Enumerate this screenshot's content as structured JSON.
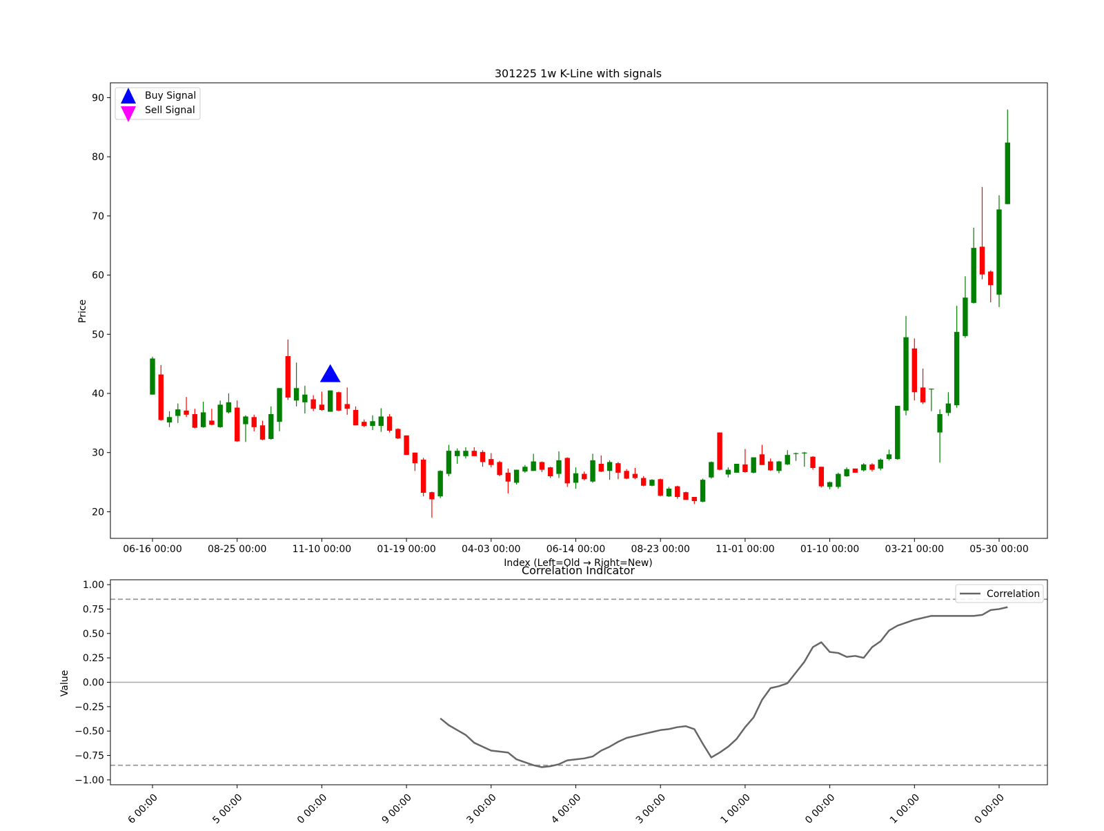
{
  "colors": {
    "up": "#008000",
    "down": "#ff0000",
    "buy": "#0000ff",
    "sell": "#ff00ff",
    "line": "#666666",
    "threshold": "#999999",
    "zero": "#aaaaaa"
  },
  "chart_data": [
    {
      "type": "candlestick",
      "title": "301225 1w K-Line with signals",
      "xlabel": "Index (Left=Old → Right=New)",
      "ylabel": "Price",
      "ylim": [
        15.5,
        92.5
      ],
      "yticks": [
        20,
        30,
        40,
        50,
        60,
        70,
        80,
        90
      ],
      "xticks": [
        {
          "label": "06-16 00:00",
          "index": 0
        },
        {
          "label": "08-25 00:00",
          "index": 10
        },
        {
          "label": "11-10 00:00",
          "index": 20
        },
        {
          "label": "01-19 00:00",
          "index": 30
        },
        {
          "label": "04-03 00:00",
          "index": 40
        },
        {
          "label": "06-14 00:00",
          "index": 50
        },
        {
          "label": "08-23 00:00",
          "index": 60
        },
        {
          "label": "11-01 00:00",
          "index": 70
        },
        {
          "label": "01-10 00:00",
          "index": 80
        },
        {
          "label": "03-21 00:00",
          "index": 90
        },
        {
          "label": "05-30 00:00",
          "index": 100
        }
      ],
      "legend": {
        "position": "upper-left",
        "entries": [
          {
            "name": "Buy Signal",
            "marker": "triangle-up"
          },
          {
            "name": "Sell Signal",
            "marker": "triangle-down"
          }
        ]
      },
      "buy_signals": [
        {
          "index": 21,
          "y": 43.2
        }
      ],
      "sell_signals": [],
      "candles": [
        {
          "o": 39.8,
          "h": 46.2,
          "l": 39.8,
          "c": 45.9
        },
        {
          "o": 43.2,
          "h": 44.8,
          "l": 35.4,
          "c": 35.5
        },
        {
          "o": 35.1,
          "h": 37.0,
          "l": 34.3,
          "c": 36.0
        },
        {
          "o": 36.2,
          "h": 38.3,
          "l": 35.0,
          "c": 37.3
        },
        {
          "o": 37.1,
          "h": 39.4,
          "l": 36.0,
          "c": 36.4
        },
        {
          "o": 36.5,
          "h": 37.4,
          "l": 34.1,
          "c": 34.2
        },
        {
          "o": 34.3,
          "h": 38.6,
          "l": 34.2,
          "c": 36.8
        },
        {
          "o": 35.4,
          "h": 37.4,
          "l": 34.6,
          "c": 34.7
        },
        {
          "o": 34.3,
          "h": 38.8,
          "l": 34.2,
          "c": 38.1
        },
        {
          "o": 36.8,
          "h": 40.0,
          "l": 36.6,
          "c": 38.5
        },
        {
          "o": 37.6,
          "h": 38.8,
          "l": 31.8,
          "c": 31.9
        },
        {
          "o": 34.8,
          "h": 36.3,
          "l": 31.8,
          "c": 36.1
        },
        {
          "o": 36.0,
          "h": 36.4,
          "l": 33.6,
          "c": 34.3
        },
        {
          "o": 34.6,
          "h": 35.4,
          "l": 32.1,
          "c": 32.2
        },
        {
          "o": 32.3,
          "h": 37.8,
          "l": 32.2,
          "c": 36.5
        },
        {
          "o": 35.2,
          "h": 40.9,
          "l": 33.6,
          "c": 40.9
        },
        {
          "o": 46.3,
          "h": 49.1,
          "l": 38.9,
          "c": 39.3
        },
        {
          "o": 38.8,
          "h": 45.2,
          "l": 37.8,
          "c": 40.9
        },
        {
          "o": 38.5,
          "h": 41.3,
          "l": 36.6,
          "c": 39.8
        },
        {
          "o": 39.0,
          "h": 39.7,
          "l": 37.0,
          "c": 37.4
        },
        {
          "o": 38.1,
          "h": 40.3,
          "l": 37.1,
          "c": 37.2
        },
        {
          "o": 36.9,
          "h": 40.5,
          "l": 36.9,
          "c": 40.5
        },
        {
          "o": 40.2,
          "h": 40.3,
          "l": 37.0,
          "c": 37.1
        },
        {
          "o": 38.2,
          "h": 41.0,
          "l": 36.4,
          "c": 37.4
        },
        {
          "o": 37.2,
          "h": 37.8,
          "l": 34.6,
          "c": 34.6
        },
        {
          "o": 35.2,
          "h": 35.6,
          "l": 34.3,
          "c": 34.5
        },
        {
          "o": 34.5,
          "h": 36.3,
          "l": 33.8,
          "c": 35.3
        },
        {
          "o": 34.5,
          "h": 37.5,
          "l": 33.5,
          "c": 36.1
        },
        {
          "o": 36.1,
          "h": 36.5,
          "l": 33.4,
          "c": 33.7
        },
        {
          "o": 34.0,
          "h": 34.1,
          "l": 32.3,
          "c": 32.4
        },
        {
          "o": 32.9,
          "h": 32.9,
          "l": 29.6,
          "c": 29.6
        },
        {
          "o": 30.0,
          "h": 30.0,
          "l": 26.9,
          "c": 28.2
        },
        {
          "o": 28.8,
          "h": 29.1,
          "l": 22.6,
          "c": 23.2
        },
        {
          "o": 23.3,
          "h": 23.4,
          "l": 19.0,
          "c": 22.1
        },
        {
          "o": 22.6,
          "h": 27.0,
          "l": 22.3,
          "c": 26.9
        },
        {
          "o": 26.4,
          "h": 31.3,
          "l": 26.0,
          "c": 30.3
        },
        {
          "o": 29.4,
          "h": 30.7,
          "l": 28.1,
          "c": 30.3
        },
        {
          "o": 29.4,
          "h": 30.9,
          "l": 29.0,
          "c": 30.3
        },
        {
          "o": 30.3,
          "h": 30.9,
          "l": 29.4,
          "c": 29.4
        },
        {
          "o": 30.1,
          "h": 30.4,
          "l": 27.6,
          "c": 28.4
        },
        {
          "o": 28.9,
          "h": 29.9,
          "l": 27.5,
          "c": 27.9
        },
        {
          "o": 28.4,
          "h": 28.6,
          "l": 26.0,
          "c": 26.2
        },
        {
          "o": 26.6,
          "h": 27.3,
          "l": 23.1,
          "c": 25.1
        },
        {
          "o": 24.9,
          "h": 27.1,
          "l": 24.6,
          "c": 27.1
        },
        {
          "o": 26.8,
          "h": 27.9,
          "l": 26.6,
          "c": 27.6
        },
        {
          "o": 26.9,
          "h": 29.8,
          "l": 26.9,
          "c": 28.5
        },
        {
          "o": 28.4,
          "h": 28.5,
          "l": 26.7,
          "c": 27.1
        },
        {
          "o": 27.5,
          "h": 27.6,
          "l": 25.7,
          "c": 26.0
        },
        {
          "o": 26.4,
          "h": 30.2,
          "l": 25.7,
          "c": 28.7
        },
        {
          "o": 29.1,
          "h": 29.2,
          "l": 24.2,
          "c": 24.8
        },
        {
          "o": 24.9,
          "h": 27.5,
          "l": 23.9,
          "c": 26.5
        },
        {
          "o": 26.4,
          "h": 26.8,
          "l": 25.3,
          "c": 25.5
        },
        {
          "o": 25.1,
          "h": 29.8,
          "l": 24.9,
          "c": 28.7
        },
        {
          "o": 28.1,
          "h": 29.5,
          "l": 26.7,
          "c": 26.8
        },
        {
          "o": 26.9,
          "h": 28.7,
          "l": 25.4,
          "c": 28.4
        },
        {
          "o": 28.2,
          "h": 28.4,
          "l": 25.5,
          "c": 26.6
        },
        {
          "o": 26.9,
          "h": 27.2,
          "l": 25.5,
          "c": 25.6
        },
        {
          "o": 26.4,
          "h": 27.4,
          "l": 25.5,
          "c": 25.7
        },
        {
          "o": 25.7,
          "h": 26.0,
          "l": 24.3,
          "c": 24.4
        },
        {
          "o": 24.4,
          "h": 25.5,
          "l": 24.3,
          "c": 25.4
        },
        {
          "o": 25.5,
          "h": 25.6,
          "l": 22.6,
          "c": 22.7
        },
        {
          "o": 22.6,
          "h": 24.2,
          "l": 22.5,
          "c": 23.9
        },
        {
          "o": 24.3,
          "h": 24.4,
          "l": 22.2,
          "c": 22.5
        },
        {
          "o": 23.3,
          "h": 23.4,
          "l": 22.0,
          "c": 22.0
        },
        {
          "o": 22.5,
          "h": 22.5,
          "l": 21.3,
          "c": 21.8
        },
        {
          "o": 21.7,
          "h": 25.6,
          "l": 21.6,
          "c": 25.4
        },
        {
          "o": 25.8,
          "h": 28.5,
          "l": 25.6,
          "c": 28.4
        },
        {
          "o": 33.4,
          "h": 33.4,
          "l": 27.0,
          "c": 27.1
        },
        {
          "o": 26.3,
          "h": 27.5,
          "l": 25.8,
          "c": 27.1
        },
        {
          "o": 26.6,
          "h": 28.1,
          "l": 26.6,
          "c": 28.1
        },
        {
          "o": 28.0,
          "h": 30.6,
          "l": 26.6,
          "c": 26.7
        },
        {
          "o": 26.6,
          "h": 29.2,
          "l": 26.5,
          "c": 29.2
        },
        {
          "o": 29.7,
          "h": 31.3,
          "l": 27.9,
          "c": 27.9
        },
        {
          "o": 28.5,
          "h": 29.0,
          "l": 26.9,
          "c": 27.0
        },
        {
          "o": 26.9,
          "h": 28.6,
          "l": 26.5,
          "c": 28.5
        },
        {
          "o": 28.0,
          "h": 30.4,
          "l": 27.9,
          "c": 29.6
        },
        {
          "o": 29.9,
          "h": 30.0,
          "l": 28.6,
          "c": 29.9
        },
        {
          "o": 30.0,
          "h": 30.1,
          "l": 27.6,
          "c": 30.0
        },
        {
          "o": 29.3,
          "h": 29.4,
          "l": 27.1,
          "c": 27.4
        },
        {
          "o": 27.6,
          "h": 27.6,
          "l": 24.1,
          "c": 24.3
        },
        {
          "o": 24.2,
          "h": 25.1,
          "l": 23.8,
          "c": 25.0
        },
        {
          "o": 24.2,
          "h": 26.6,
          "l": 23.9,
          "c": 26.4
        },
        {
          "o": 26.0,
          "h": 27.5,
          "l": 25.9,
          "c": 27.2
        },
        {
          "o": 27.3,
          "h": 27.3,
          "l": 26.6,
          "c": 26.6
        },
        {
          "o": 27.0,
          "h": 28.2,
          "l": 26.8,
          "c": 28.0
        },
        {
          "o": 28.0,
          "h": 28.2,
          "l": 26.8,
          "c": 27.1
        },
        {
          "o": 27.3,
          "h": 29.0,
          "l": 27.0,
          "c": 28.8
        },
        {
          "o": 28.9,
          "h": 30.5,
          "l": 28.7,
          "c": 29.7
        },
        {
          "o": 28.9,
          "h": 37.9,
          "l": 28.8,
          "c": 37.9
        },
        {
          "o": 37.1,
          "h": 53.1,
          "l": 36.3,
          "c": 49.5
        },
        {
          "o": 47.6,
          "h": 49.3,
          "l": 38.8,
          "c": 40.2
        },
        {
          "o": 41.0,
          "h": 44.2,
          "l": 38.2,
          "c": 38.5
        },
        {
          "o": 40.8,
          "h": 40.8,
          "l": 37.0,
          "c": 40.8
        },
        {
          "o": 33.4,
          "h": 37.3,
          "l": 28.3,
          "c": 36.5
        },
        {
          "o": 36.7,
          "h": 40.2,
          "l": 36.2,
          "c": 38.3
        },
        {
          "o": 38.0,
          "h": 54.8,
          "l": 37.6,
          "c": 50.4
        },
        {
          "o": 49.7,
          "h": 59.8,
          "l": 49.4,
          "c": 56.2
        },
        {
          "o": 55.3,
          "h": 68.0,
          "l": 55.2,
          "c": 64.6
        },
        {
          "o": 64.8,
          "h": 74.9,
          "l": 59.3,
          "c": 60.1
        },
        {
          "o": 60.6,
          "h": 60.8,
          "l": 55.4,
          "c": 58.3
        },
        {
          "o": 56.7,
          "h": 73.5,
          "l": 54.6,
          "c": 71.1
        },
        {
          "o": 72.0,
          "h": 88.0,
          "l": 72.0,
          "c": 82.4
        }
      ]
    },
    {
      "type": "line",
      "title": "Correlation Indicator",
      "ylabel": "Value",
      "xlabel": "",
      "ylim": [
        -1.05,
        1.05
      ],
      "yticks": [
        {
          "v": 1.0,
          "label": "1.00"
        },
        {
          "v": 0.75,
          "label": "0.75"
        },
        {
          "v": 0.5,
          "label": "0.50"
        },
        {
          "v": 0.25,
          "label": "0.25"
        },
        {
          "v": 0.0,
          "label": "0.00"
        },
        {
          "v": -0.25,
          "label": "−0.25"
        },
        {
          "v": -0.5,
          "label": "−0.50"
        },
        {
          "v": -0.75,
          "label": "−0.75"
        },
        {
          "v": -1.0,
          "label": "−1.00"
        }
      ],
      "xticks": [
        {
          "label": "6 00:00",
          "index": 0
        },
        {
          "label": "5 00:00",
          "index": 10
        },
        {
          "label": "0 00:00",
          "index": 20
        },
        {
          "label": "9 00:00",
          "index": 30
        },
        {
          "label": "3 00:00",
          "index": 40
        },
        {
          "label": "4 00:00",
          "index": 50
        },
        {
          "label": "3 00:00",
          "index": 60
        },
        {
          "label": "1 00:00",
          "index": 70
        },
        {
          "label": "0 00:00",
          "index": 80
        },
        {
          "label": "1 00:00",
          "index": 90
        },
        {
          "label": "0 00:00",
          "index": 100
        }
      ],
      "thresholds": [
        0.85,
        -0.85
      ],
      "zero_line": 0,
      "legend": {
        "position": "upper-right",
        "entries": [
          {
            "name": "Correlation"
          }
        ]
      },
      "series": [
        {
          "name": "Correlation",
          "start_index": 34,
          "values": [
            -0.37,
            -0.44,
            -0.49,
            -0.54,
            -0.62,
            -0.66,
            -0.7,
            -0.71,
            -0.72,
            -0.79,
            -0.82,
            -0.85,
            -0.87,
            -0.86,
            -0.84,
            -0.8,
            -0.79,
            -0.78,
            -0.76,
            -0.7,
            -0.66,
            -0.61,
            -0.57,
            -0.55,
            -0.53,
            -0.51,
            -0.49,
            -0.48,
            -0.46,
            -0.45,
            -0.48,
            -0.63,
            -0.77,
            -0.72,
            -0.66,
            -0.58,
            -0.46,
            -0.36,
            -0.18,
            -0.06,
            -0.04,
            -0.01,
            0.1,
            0.21,
            0.36,
            0.41,
            0.31,
            0.3,
            0.26,
            0.27,
            0.25,
            0.36,
            0.42,
            0.53,
            0.58,
            0.61,
            0.64,
            0.66,
            0.68,
            0.68,
            0.68,
            0.68,
            0.68,
            0.68,
            0.69,
            0.74,
            0.75,
            0.77
          ]
        }
      ]
    }
  ]
}
